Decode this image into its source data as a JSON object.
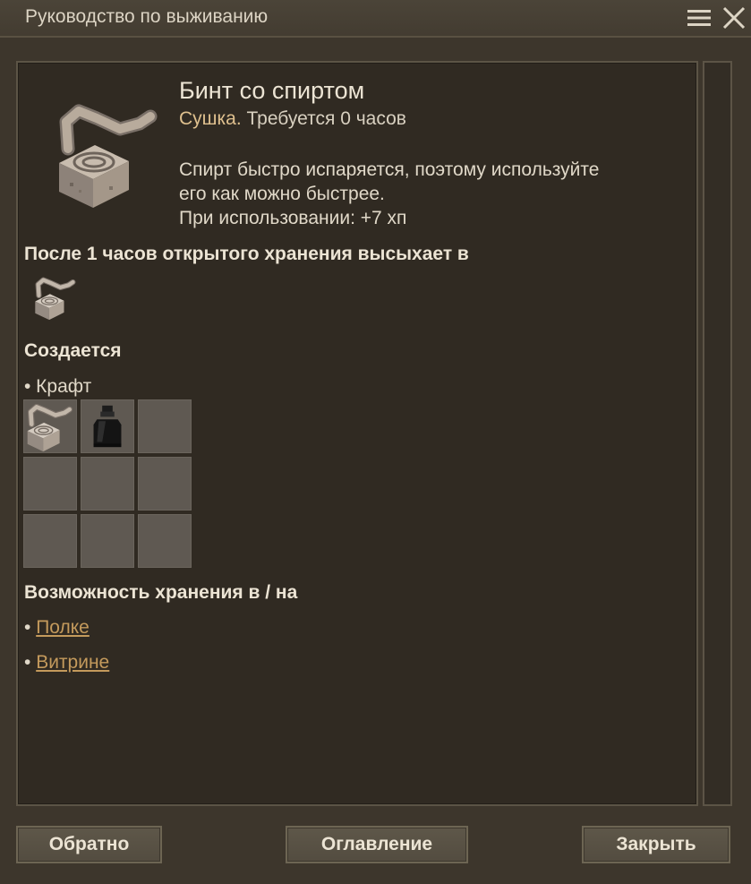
{
  "window": {
    "title": "Руководство по выживанию"
  },
  "item": {
    "name": "Бинт со спиртом",
    "process": "Сушка.",
    "process_detail": " Требуется 0 часов",
    "description_lines": [
      "Спирт быстро испаряется, поэтому используйте",
      "его как можно быстрее.",
      "При использовании: +7 хп"
    ]
  },
  "drying": {
    "heading": "После 1 часов открытого хранения высыхает в"
  },
  "creation": {
    "heading": "Создается",
    "method": "• Крафт"
  },
  "storage": {
    "heading": "Возможность хранения в / на",
    "bullet": "• ",
    "places": [
      "Полке",
      "Витрине"
    ]
  },
  "buttons": {
    "back": "Обратно",
    "contents": "Оглавление",
    "close": "Закрыть"
  },
  "colors": {
    "accent_process": "#dfc08e",
    "link": "#c49a5c",
    "background": "#3d362c",
    "panel": "#302a22"
  },
  "icons": {
    "menu": "hamburger-menu-icon",
    "close": "close-x-icon",
    "item": "alcohol-bandage-icon",
    "dried_item": "bandage-icon",
    "ingredient_1": "bandage-icon",
    "ingredient_2": "alcohol-bottle-icon"
  }
}
